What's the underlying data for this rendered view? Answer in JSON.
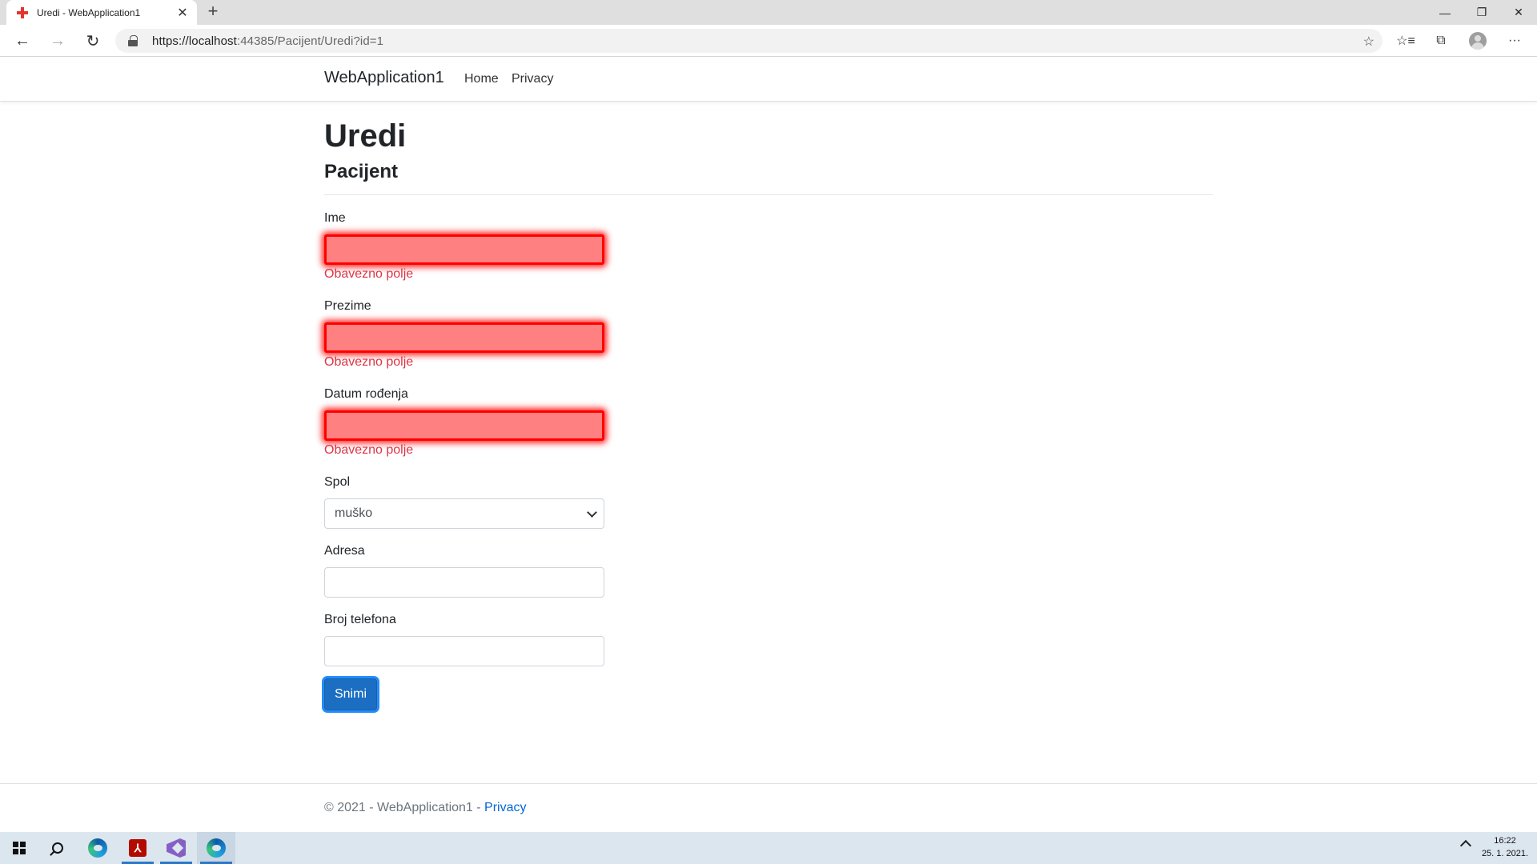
{
  "browser": {
    "tab_title": "Uredi - WebApplication1",
    "url_host": "https://localhost",
    "url_rest": ":44385/Pacijent/Uredi?id=1"
  },
  "navbar": {
    "brand": "WebApplication1",
    "links": [
      "Home",
      "Privacy"
    ]
  },
  "page": {
    "title": "Uredi",
    "subtitle": "Pacijent"
  },
  "form": {
    "fields": [
      {
        "label": "Ime",
        "value": "",
        "error": "Obavezno polje"
      },
      {
        "label": "Prezime",
        "value": "",
        "error": "Obavezno polje"
      },
      {
        "label": "Datum rođenja",
        "value": "",
        "error": "Obavezno polje"
      },
      {
        "label": "Spol",
        "value": "muško"
      },
      {
        "label": "Adresa",
        "value": ""
      },
      {
        "label": "Broj telefona",
        "value": ""
      }
    ],
    "submit_label": "Snimi"
  },
  "footer": {
    "text": "© 2021 - WebApplication1 - ",
    "link": "Privacy"
  },
  "taskbar": {
    "time": "16:22",
    "date": "25. 1. 2021."
  },
  "colors": {
    "primary_button": "#1b6ec2",
    "invalid_field": "#ff8080",
    "error_text": "#dc3545",
    "link": "#0366d6"
  }
}
